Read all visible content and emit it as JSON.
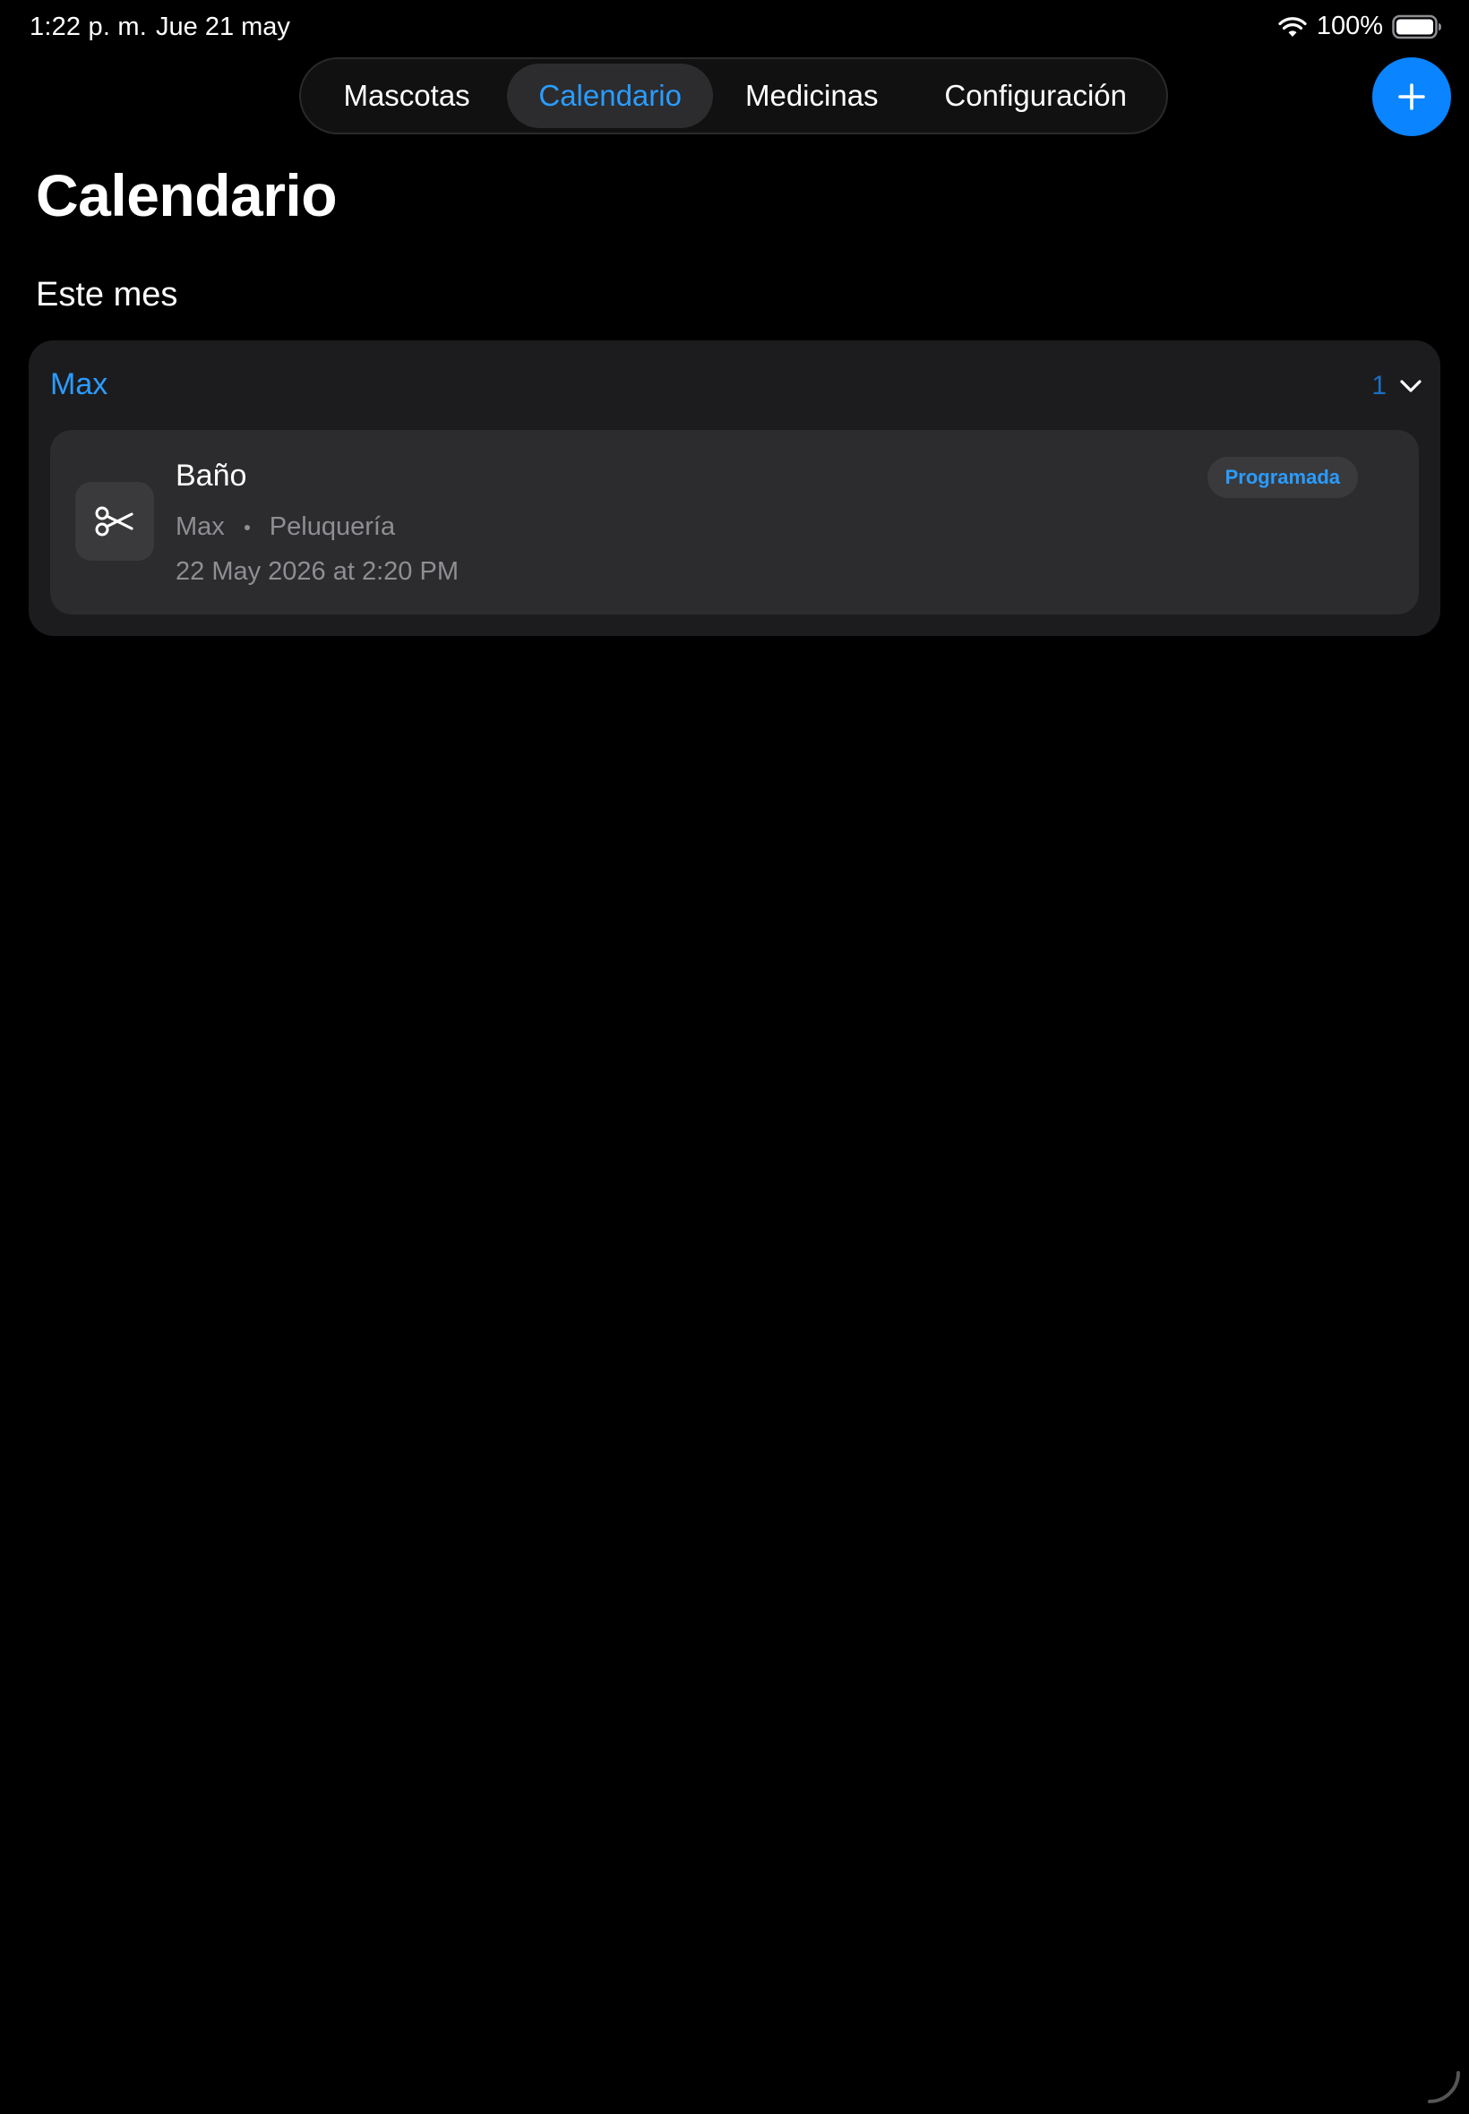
{
  "status_bar": {
    "time": "1:22 p. m.",
    "date": "Jue 21 may",
    "battery": "100%"
  },
  "tabs": [
    {
      "label": "Mascotas"
    },
    {
      "label": "Calendario",
      "selected": true
    },
    {
      "label": "Medicinas"
    },
    {
      "label": "Configuración"
    }
  ],
  "page": {
    "title": "Calendario",
    "section": "Este mes"
  },
  "group": {
    "name": "Max",
    "count": "1",
    "event": {
      "icon": "scissors-icon",
      "title": "Baño",
      "pet": "Max",
      "category": "Peluquería",
      "datetime": "22 May 2026 at 2:20 PM",
      "status": "Programada"
    }
  },
  "colors": {
    "accent": "#0a84ff",
    "link": "#2a9cff",
    "background": "#000000",
    "card": "#1c1c1e",
    "card_inner": "#2c2c2e",
    "secondary_text": "#8e8e93"
  }
}
